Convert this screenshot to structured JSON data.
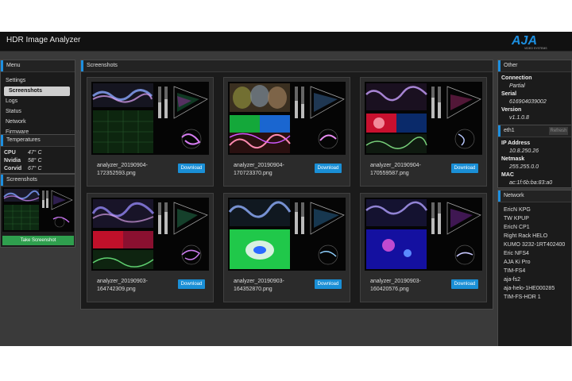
{
  "app": {
    "title": "HDR Image Analyzer",
    "logo_text": "AJA",
    "logo_subtext": "VIDEO SYSTEMS"
  },
  "menu": {
    "header": "Menu",
    "items": [
      {
        "label": "Settings",
        "active": false
      },
      {
        "label": "Screenshots",
        "active": true
      },
      {
        "label": "Logs",
        "active": false
      },
      {
        "label": "Status",
        "active": false
      },
      {
        "label": "Network",
        "active": false
      },
      {
        "label": "Firmware",
        "active": false
      }
    ]
  },
  "temperatures": {
    "header": "Temperatures",
    "rows": [
      {
        "label": "CPU",
        "value": "47° C"
      },
      {
        "label": "Nvidia",
        "value": "58° C"
      },
      {
        "label": "Corvid",
        "value": "67° C"
      }
    ]
  },
  "screenshots_side": {
    "header": "Screenshots",
    "button": "Take Screenshot"
  },
  "main": {
    "header": "Screenshots",
    "download_label": "Download",
    "cards": [
      {
        "line1": "analyzer_20190904-",
        "line2": "172352593.png"
      },
      {
        "line1": "analyzer_20190904-",
        "line2": "170723370.png"
      },
      {
        "line1": "analyzer_20190904-",
        "line2": "170559587.png"
      },
      {
        "line1": "analyzer_20190903-",
        "line2": "164742309.png"
      },
      {
        "line1": "analyzer_20190903-",
        "line2": "164352870.png"
      },
      {
        "line1": "analyzer_20190903-",
        "line2": "160420576.png"
      }
    ]
  },
  "other": {
    "header": "Other",
    "connection_label": "Connection",
    "connection_value": "Partial",
    "serial_label": "Serial",
    "serial_value": "616904039002",
    "version_label": "Version",
    "version_value": "v1.1.0.8"
  },
  "eth": {
    "header": "eth1",
    "refresh": "Refresh",
    "ip_label": "IP Address",
    "ip_value": "10.8.250.26",
    "netmask_label": "Netmask",
    "netmask_value": "255.255.0.0",
    "mac_label": "MAC",
    "mac_value": "ac:1f:6b:ba:83:a0"
  },
  "network": {
    "header": "Network",
    "items": [
      "EricN KPG",
      "TW KPUP",
      "EricN CP1",
      "Right Rack HELO",
      "KUMO 3232-1RT402400",
      "Eric NFS4",
      "AJA Ki Pro",
      "TIM-FS4",
      "aja-fs2",
      "aja-helo-1HE000285",
      "TIM-FS-HDR 1"
    ]
  },
  "colors": {
    "accent": "#1c8fe0",
    "download": "#1a8fd6",
    "take_screenshot": "#2f9f4e",
    "background": "#3a3a3a"
  }
}
